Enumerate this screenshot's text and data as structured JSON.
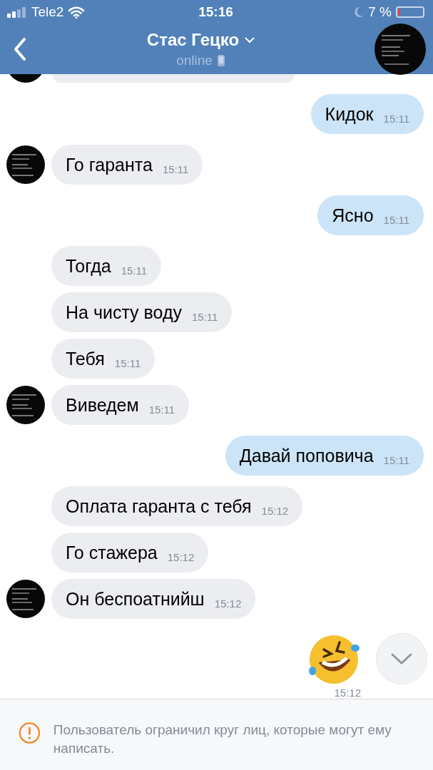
{
  "status_bar": {
    "carrier": "Tele2",
    "time": "15:16",
    "battery": "7 %"
  },
  "header": {
    "title": "Стас Гецко",
    "status": "online"
  },
  "messages": [
    {
      "kind": "text",
      "outgoing": true,
      "text": "Кидок",
      "time": "15:11",
      "avatar": false
    },
    {
      "kind": "text",
      "outgoing": false,
      "text": "Го гаранта",
      "time": "15:11",
      "avatar": true
    },
    {
      "kind": "text",
      "outgoing": true,
      "text": "Ясно",
      "time": "15:11",
      "avatar": false
    },
    {
      "kind": "text",
      "outgoing": false,
      "text": "Тогда",
      "time": "15:11",
      "avatar": false
    },
    {
      "kind": "text",
      "outgoing": false,
      "text": "На чисту воду",
      "time": "15:11",
      "avatar": false
    },
    {
      "kind": "text",
      "outgoing": false,
      "text": "Тебя",
      "time": "15:11",
      "avatar": false
    },
    {
      "kind": "text",
      "outgoing": false,
      "text": "Виведем",
      "time": "15:11",
      "avatar": true
    },
    {
      "kind": "text",
      "outgoing": true,
      "text": "Давай поповича",
      "time": "15:11",
      "avatar": false
    },
    {
      "kind": "text",
      "outgoing": false,
      "text": "Оплата гаранта с тебя",
      "time": "15:12",
      "avatar": false
    },
    {
      "kind": "text",
      "outgoing": false,
      "text": "Го стажера",
      "time": "15:12",
      "avatar": false
    },
    {
      "kind": "text",
      "outgoing": false,
      "text": "Он беспоатнийш",
      "time": "15:12",
      "avatar": true
    },
    {
      "kind": "emoji",
      "outgoing": true,
      "time": "15:12",
      "avatar": false
    }
  ],
  "notice": "Пользователь ограничил круг лиц, которые могут ему написать."
}
